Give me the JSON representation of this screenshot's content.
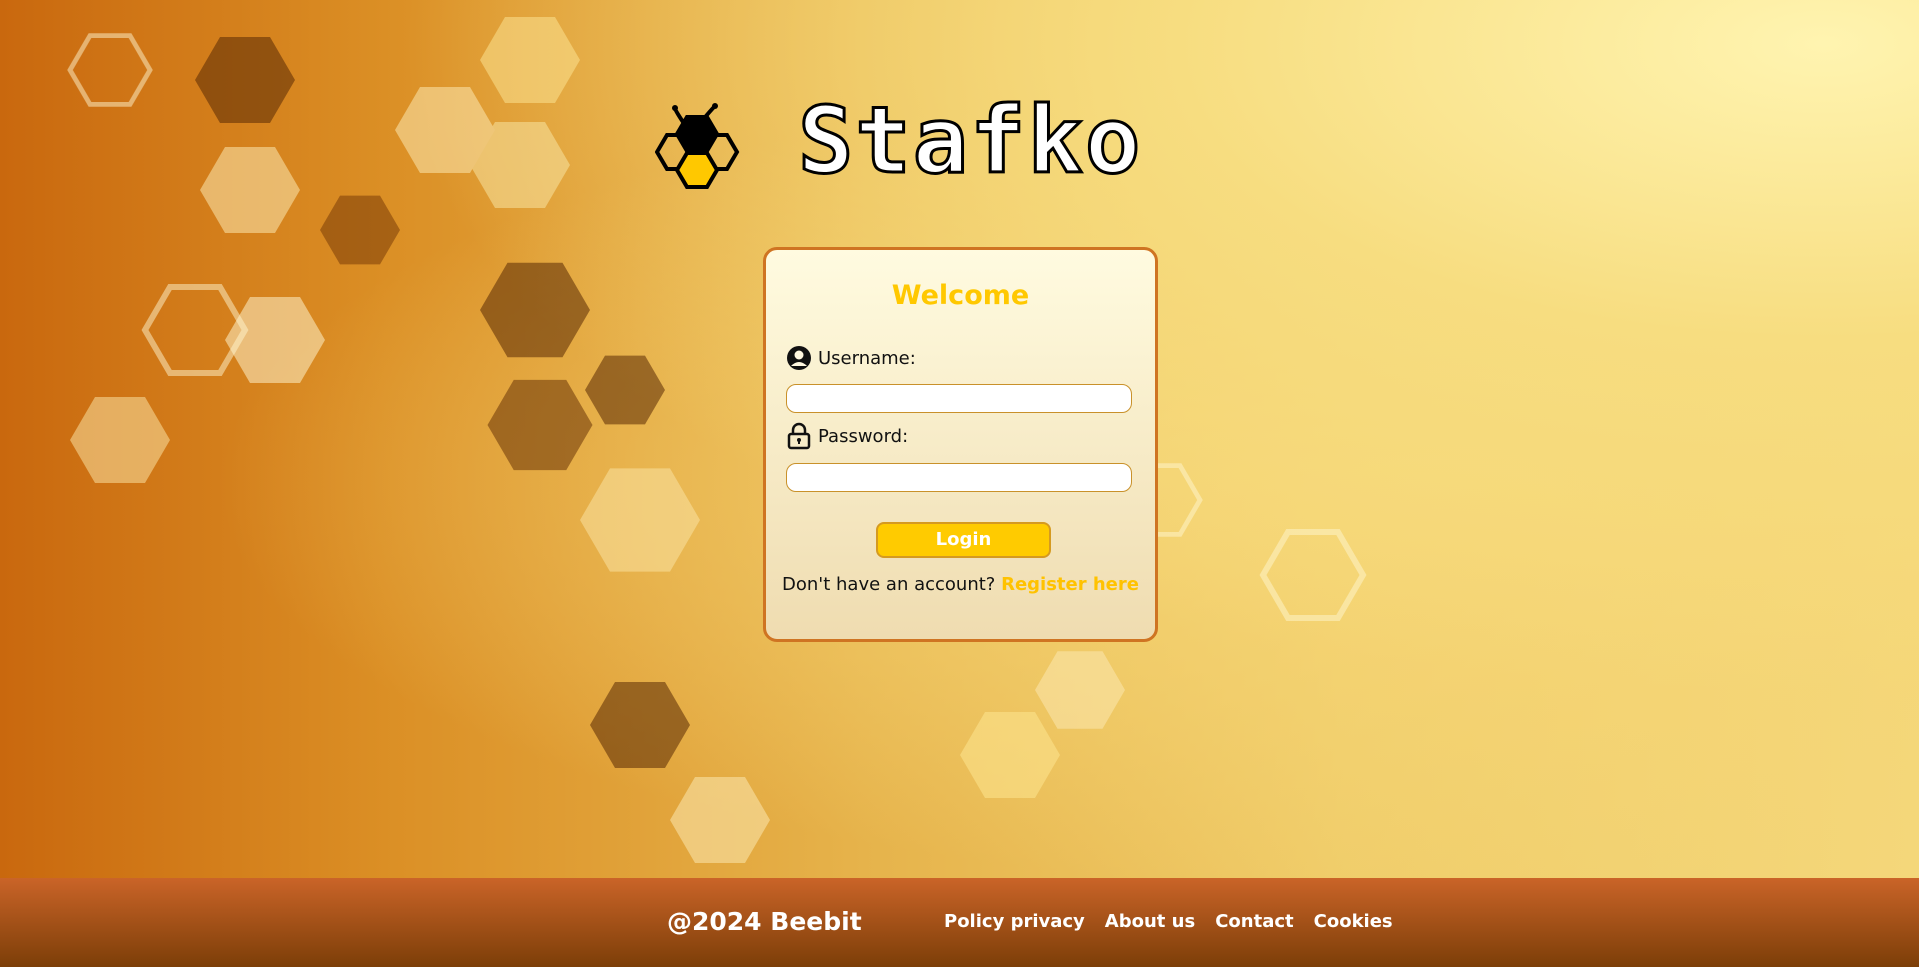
{
  "brand": {
    "name": "Stafko"
  },
  "login": {
    "title": "Welcome",
    "username_label": "Username:",
    "username_value": "",
    "password_label": "Password:",
    "password_value": "",
    "login_button": "Login",
    "register_prompt": "Don't have an account?",
    "register_link": "Register here"
  },
  "footer": {
    "copyright": "@2024 Beebit",
    "links": [
      "Policy privacy",
      "About us",
      "Contact",
      "Cookies"
    ]
  },
  "colors": {
    "accent": "#ffcb00",
    "card_border": "#cf7422",
    "footer": "#ca6428"
  },
  "icons": {
    "username": "user-circle-icon",
    "password": "lock-icon",
    "logo": "bee-hexagon-icon"
  }
}
